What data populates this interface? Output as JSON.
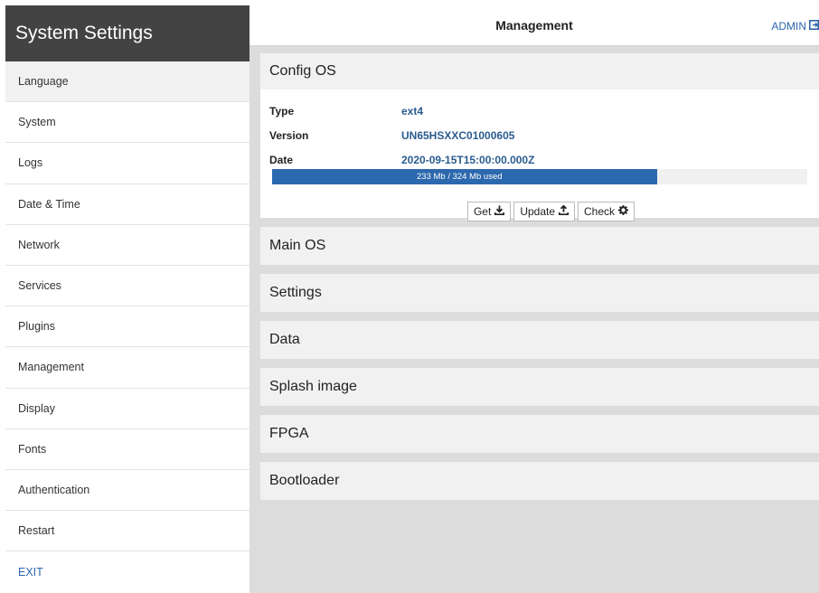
{
  "sidebar": {
    "title": "System Settings",
    "items": [
      {
        "label": "Language"
      },
      {
        "label": "System"
      },
      {
        "label": "Logs"
      },
      {
        "label": "Date & Time"
      },
      {
        "label": "Network"
      },
      {
        "label": "Services"
      },
      {
        "label": "Plugins"
      },
      {
        "label": "Management"
      },
      {
        "label": "Display"
      },
      {
        "label": "Fonts"
      },
      {
        "label": "Authentication"
      },
      {
        "label": "Restart"
      },
      {
        "label": "EXIT"
      }
    ]
  },
  "header": {
    "title": "Management",
    "admin_label": "ADMIN",
    "admin_icon": "sign-out-icon"
  },
  "config_os": {
    "title": "Config OS",
    "type_label": "Type",
    "type_value": "ext4",
    "version_label": "Version",
    "version_value": "UN65HSXXC01000605",
    "date_label": "Date",
    "date_value": "2020-09-15T15:00:00.000Z",
    "storage_text": "233 Mb / 324 Mb used",
    "storage_fraction": 0.719,
    "buttons": {
      "get_label": "Get",
      "update_label": "Update",
      "check_label": "Check"
    }
  },
  "sections": [
    {
      "title": "Main OS"
    },
    {
      "title": "Settings"
    },
    {
      "title": "Data"
    },
    {
      "title": "Splash image"
    },
    {
      "title": "FPGA"
    },
    {
      "title": "Bootloader"
    }
  ],
  "colors": {
    "accent": "#2c68ae",
    "sidebar_header": "#434343",
    "link": "#2d66ad"
  }
}
